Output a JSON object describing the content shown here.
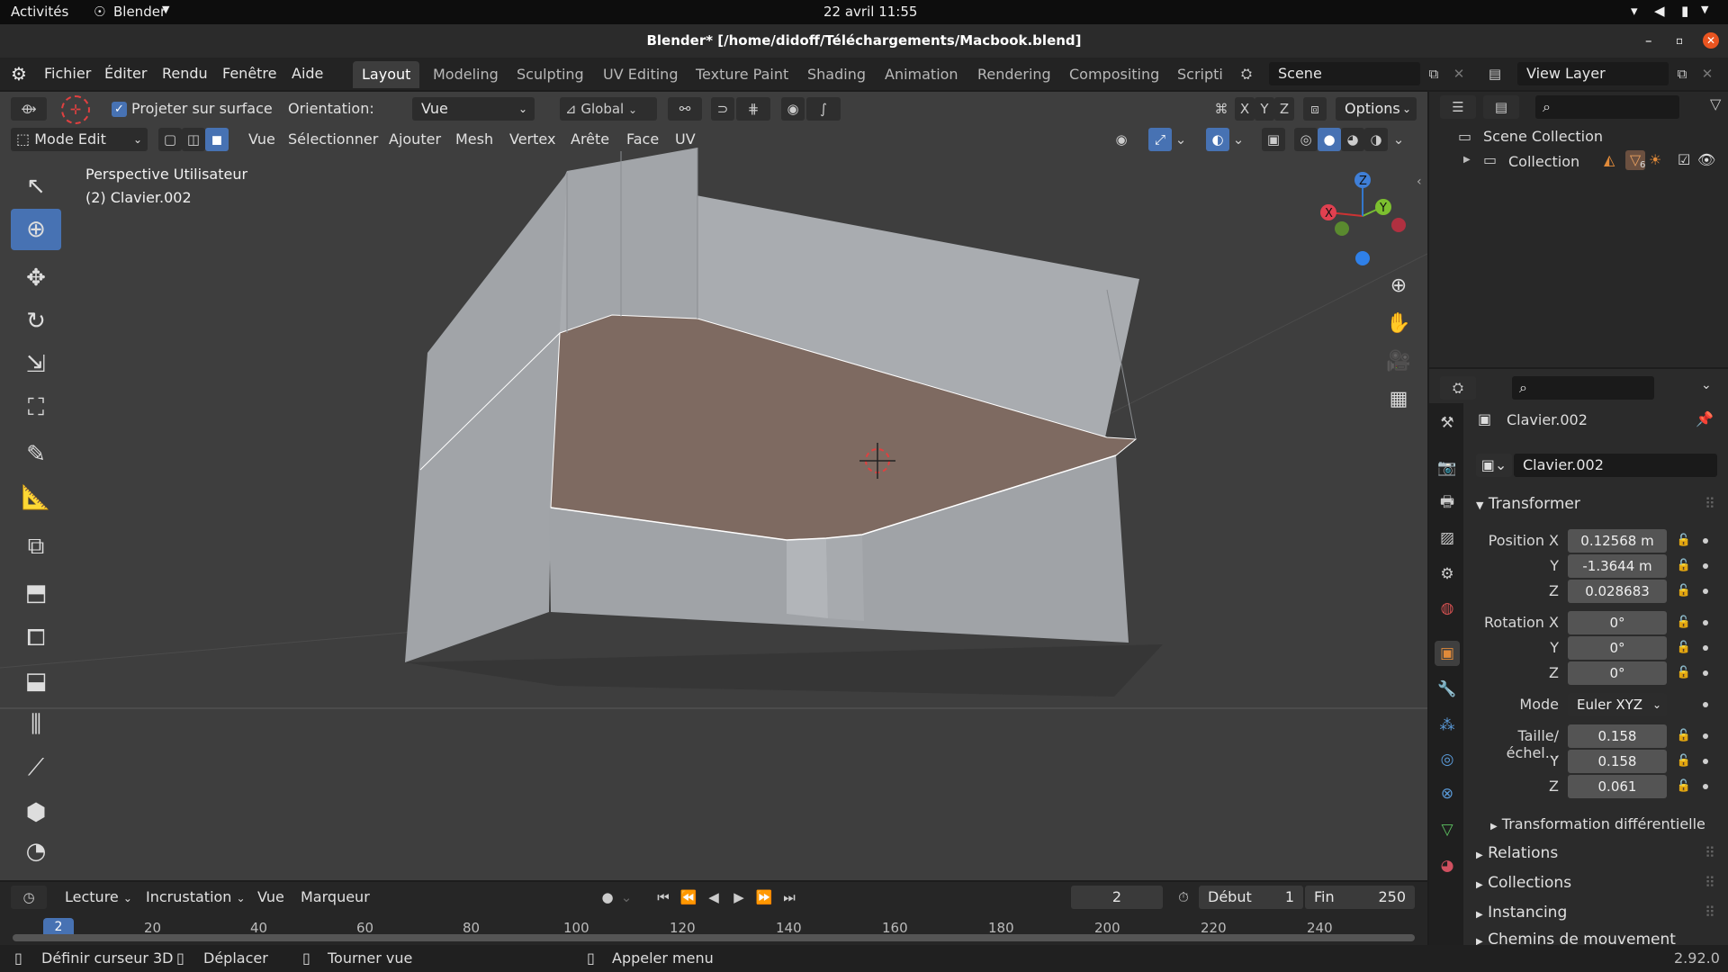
{
  "system": {
    "activities": "Activités",
    "app": "Blender",
    "clock": "22 avril  11:55"
  },
  "title": "Blender* [/home/didoff/Téléchargements/Macbook.blend]",
  "menu": {
    "items": [
      "Fichier",
      "Éditer",
      "Rendu",
      "Fenêtre",
      "Aide"
    ]
  },
  "workspaces": [
    "Layout",
    "Modeling",
    "Sculpting",
    "UV Editing",
    "Texture Paint",
    "Shading",
    "Animation",
    "Rendering",
    "Compositing",
    "Scripti"
  ],
  "scene": {
    "label": "Scene"
  },
  "viewlayer": {
    "label": "View Layer"
  },
  "toolheader": {
    "project_label": "Projeter sur surface",
    "orientation_label": "Orientation:",
    "orientation_value": "Vue",
    "transform_value": "Global",
    "axes": [
      "X",
      "Y",
      "Z"
    ],
    "options_label": "Options"
  },
  "viewheader": {
    "mode": "Mode Edit",
    "menus": [
      "Vue",
      "Sélectionner",
      "Ajouter",
      "Mesh",
      "Vertex",
      "Arête",
      "Face",
      "UV"
    ]
  },
  "viewport": {
    "perspective": "Perspective Utilisateur",
    "object": "(2) Clavier.002"
  },
  "gizmo": {
    "x": "X",
    "y": "Y",
    "z": "Z"
  },
  "outliner": {
    "scene_collection": "Scene Collection",
    "collection": "Collection",
    "badge": "6"
  },
  "properties": {
    "object_name": "Clavier.002",
    "mesh_name": "Clavier.002",
    "transform_section": "Transformer",
    "position_label": "Position X",
    "position": [
      "0.12568 m",
      "-1.3644 m",
      "0.028683"
    ],
    "rotation_label": "Rotation X",
    "rotation": [
      "0°",
      "0°",
      "0°"
    ],
    "mode_label": "Mode",
    "mode_value": "Euler XYZ",
    "scale_label": "Taille/échel...",
    "scale": [
      "0.158",
      "0.158",
      "0.061"
    ],
    "axis_y": "Y",
    "axis_z": "Z",
    "delta": "Transformation différentielle",
    "sections": [
      "Relations",
      "Collections",
      "Instancing",
      "Chemins de mouvement"
    ]
  },
  "timeline": {
    "menus": [
      "Lecture",
      "Incrustation",
      "Vue",
      "Marqueur"
    ],
    "current_frame": "2",
    "start_label": "Début",
    "start": "1",
    "end_label": "Fin",
    "end": "250",
    "ruler": [
      "2",
      "20",
      "40",
      "60",
      "80",
      "100",
      "120",
      "140",
      "160",
      "180",
      "200",
      "220",
      "240"
    ]
  },
  "status": {
    "hints": [
      "Définir curseur 3D",
      "Déplacer",
      "Tourner vue",
      "Appeler menu"
    ],
    "version": "2.92.0"
  },
  "colors": {
    "accent": "#4772b3",
    "selected_face": "#7d6a61",
    "background": "#3e3e3e"
  }
}
